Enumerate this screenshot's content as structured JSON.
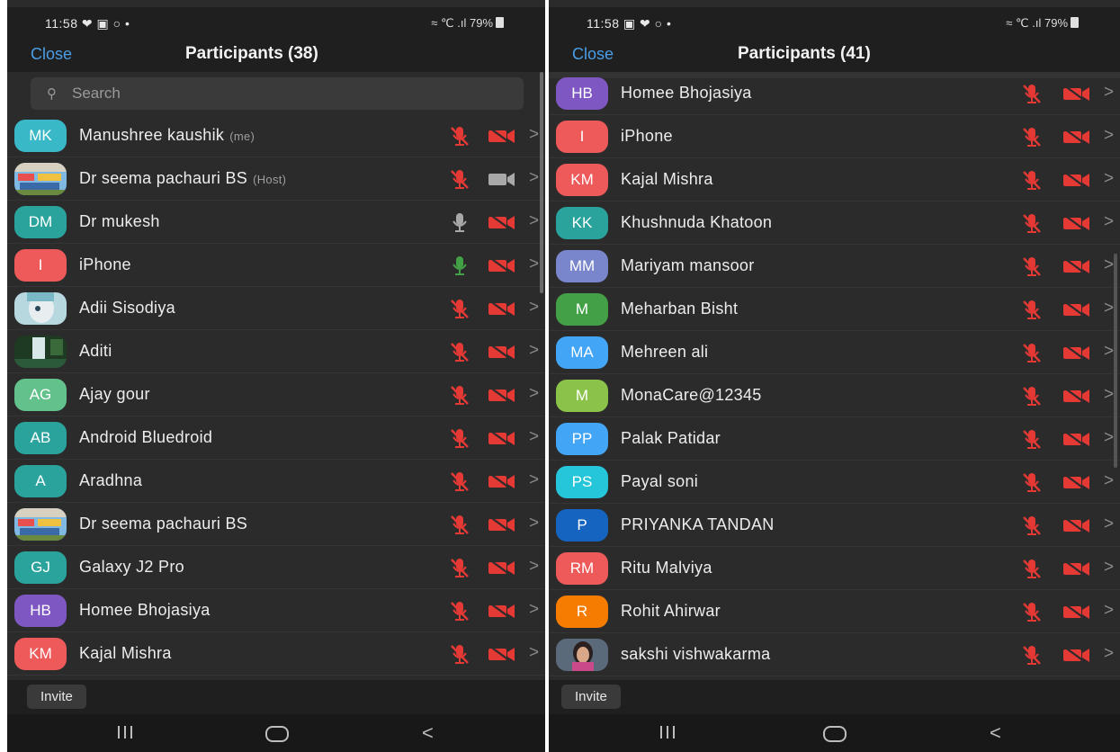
{
  "colors": {
    "mic_muted": "#e53935",
    "mic_on_gray": "#a8a8a8",
    "mic_speaking": "#43a047",
    "cam_off": "#e53935",
    "cam_on": "#a8a8a8",
    "link": "#4a9ee8"
  },
  "left_screen": {
    "status": {
      "time": "11:58 ❤ ▣ ○ •",
      "signal": "≈ ℃ .ıl 79%"
    },
    "header": {
      "close_label": "Close",
      "title": "Participants (38)"
    },
    "search": {
      "placeholder": "Search"
    },
    "participants": [
      {
        "initials": "MK",
        "name": "Manushree kaushik",
        "tag": "(me)",
        "avatar_color": "#39b8c8",
        "mic": "muted",
        "camera": "off"
      },
      {
        "initials": "",
        "name": "Dr seema pachauri BS",
        "tag": "(Host)",
        "avatar_color": "#5aa0d8",
        "photo": "classroom",
        "mic": "muted",
        "camera": "on"
      },
      {
        "initials": "DM",
        "name": "Dr mukesh",
        "tag": "",
        "avatar_color": "#2aa39c",
        "mic": "on",
        "camera": "off"
      },
      {
        "initials": "I",
        "name": "iPhone",
        "tag": "",
        "avatar_color": "#ee5a5a",
        "mic": "speaking",
        "camera": "off"
      },
      {
        "initials": "",
        "name": "Adii Sisodiya",
        "tag": "",
        "avatar_color": "#6fb4c4",
        "photo": "portrait",
        "mic": "muted",
        "camera": "off"
      },
      {
        "initials": "",
        "name": "Aditi",
        "tag": "",
        "avatar_color": "#3d5d40",
        "photo": "waterfall",
        "mic": "muted",
        "camera": "off"
      },
      {
        "initials": "AG",
        "name": "Ajay gour",
        "tag": "",
        "avatar_color": "#63c18c",
        "mic": "muted",
        "camera": "off"
      },
      {
        "initials": "AB",
        "name": "Android Bluedroid",
        "tag": "",
        "avatar_color": "#2aa39c",
        "mic": "muted",
        "camera": "off"
      },
      {
        "initials": "A",
        "name": "Aradhna",
        "tag": "",
        "avatar_color": "#2aa39c",
        "mic": "muted",
        "camera": "off"
      },
      {
        "initials": "",
        "name": "Dr seema pachauri BS",
        "tag": "",
        "avatar_color": "#5aa0d8",
        "photo": "classroom",
        "mic": "muted",
        "camera": "off"
      },
      {
        "initials": "GJ",
        "name": "Galaxy J2 Pro",
        "tag": "",
        "avatar_color": "#2aa39c",
        "mic": "muted",
        "camera": "off"
      },
      {
        "initials": "HB",
        "name": "Homee Bhojasiya",
        "tag": "",
        "avatar_color": "#7e57c2",
        "mic": "muted",
        "camera": "off"
      },
      {
        "initials": "KM",
        "name": "Kajal Mishra",
        "tag": "",
        "avatar_color": "#ee5a5a",
        "mic": "muted",
        "camera": "off"
      }
    ],
    "footer": {
      "invite_label": "Invite"
    }
  },
  "right_screen": {
    "status": {
      "time": "11:58 ▣ ❤ ○ •",
      "signal": "≈ ℃ .ıl 79%"
    },
    "header": {
      "close_label": "Close",
      "title": "Participants (41)"
    },
    "participants": [
      {
        "initials": "HB",
        "name": "Homee Bhojasiya",
        "tag": "",
        "avatar_color": "#7e57c2",
        "mic": "muted",
        "camera": "off"
      },
      {
        "initials": "I",
        "name": "iPhone",
        "tag": "",
        "avatar_color": "#ee5a5a",
        "mic": "muted",
        "camera": "off"
      },
      {
        "initials": "KM",
        "name": "Kajal Mishra",
        "tag": "",
        "avatar_color": "#ee5a5a",
        "mic": "muted",
        "camera": "off"
      },
      {
        "initials": "KK",
        "name": "Khushnuda Khatoon",
        "tag": "",
        "avatar_color": "#2aa39c",
        "mic": "muted",
        "camera": "off"
      },
      {
        "initials": "MM",
        "name": "Mariyam mansoor",
        "tag": "",
        "avatar_color": "#7986cb",
        "mic": "muted",
        "camera": "off"
      },
      {
        "initials": "M",
        "name": "Meharban Bisht",
        "tag": "",
        "avatar_color": "#43a047",
        "mic": "muted",
        "camera": "off"
      },
      {
        "initials": "MA",
        "name": "Mehreen ali",
        "tag": "",
        "avatar_color": "#42a5f5",
        "mic": "muted",
        "camera": "off"
      },
      {
        "initials": "M",
        "name": "MonaCare@12345",
        "tag": "",
        "avatar_color": "#8bc34a",
        "mic": "muted",
        "camera": "off"
      },
      {
        "initials": "PP",
        "name": "Palak Patidar",
        "tag": "",
        "avatar_color": "#42a5f5",
        "mic": "muted",
        "camera": "off"
      },
      {
        "initials": "PS",
        "name": "Payal soni",
        "tag": "",
        "avatar_color": "#26c6da",
        "mic": "muted",
        "camera": "off"
      },
      {
        "initials": "P",
        "name": "PRIYANKA TANDAN",
        "tag": "",
        "avatar_color": "#1565c0",
        "mic": "muted",
        "camera": "off"
      },
      {
        "initials": "RM",
        "name": "Ritu Malviya",
        "tag": "",
        "avatar_color": "#ee5a5a",
        "mic": "muted",
        "camera": "off"
      },
      {
        "initials": "R",
        "name": "Rohit Ahirwar",
        "tag": "",
        "avatar_color": "#f57c00",
        "mic": "muted",
        "camera": "off"
      },
      {
        "initials": "",
        "name": "sakshi vishwakarma",
        "tag": "",
        "avatar_color": "#6a7a8a",
        "photo": "selfie",
        "mic": "muted",
        "camera": "off"
      }
    ],
    "footer": {
      "invite_label": "Invite"
    }
  }
}
